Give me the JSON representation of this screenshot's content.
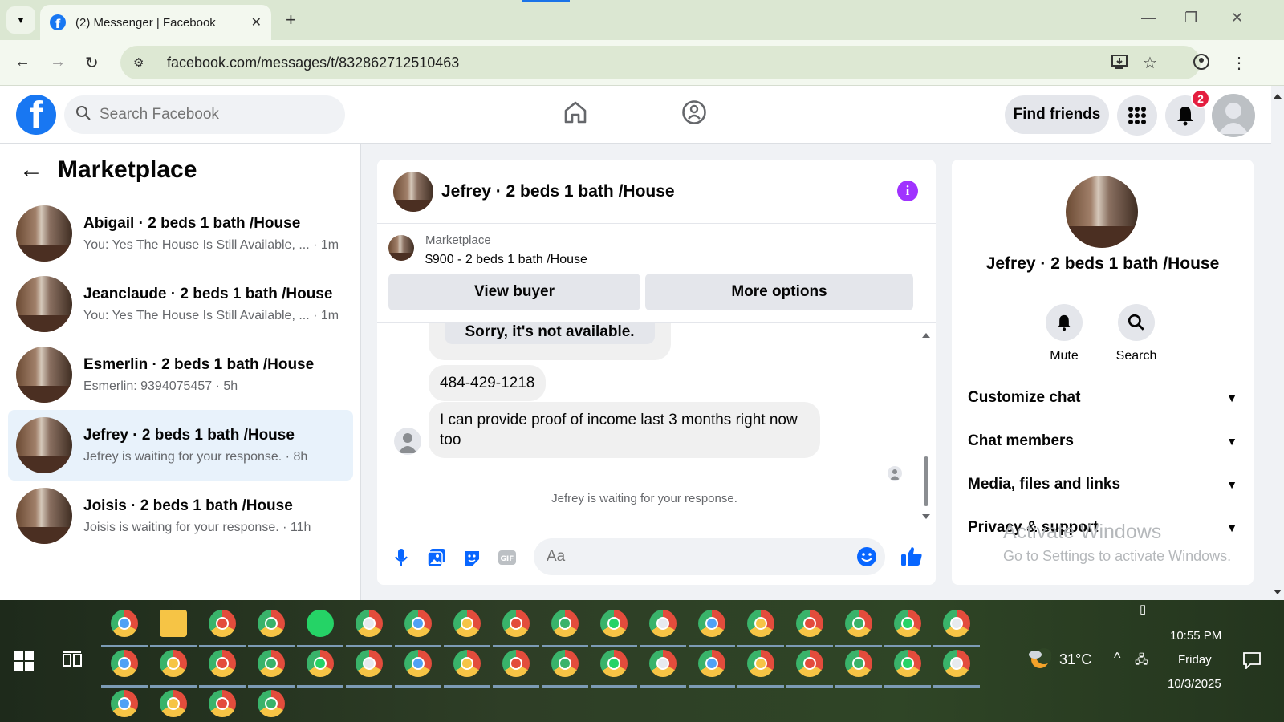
{
  "browser": {
    "tab_title": "(2) Messenger | Facebook",
    "url": "facebook.com/messages/t/832862712510463",
    "new_tab": "+",
    "close_tab": "✕"
  },
  "facebook": {
    "logo": "f",
    "search_placeholder": "Search Facebook",
    "find_friends": "Find friends",
    "notification_count": "2",
    "left_title": "Marketplace",
    "conversations": [
      {
        "name": "Abigail · 2 beds 1 bath /House",
        "snippet": "You: Yes The House Is Still Available, ...  · 1m"
      },
      {
        "name": "Jeanclaude · 2 beds 1 bath /House",
        "snippet": "You: Yes The House Is Still Available, ...  · 1m"
      },
      {
        "name": "Esmerlin · 2 beds 1 bath /House",
        "snippet": "Esmerlin: 9394075457 · 5h"
      },
      {
        "name": "Jefrey · 2 beds 1 bath /House",
        "snippet": "Jefrey is waiting for your response. · 8h"
      },
      {
        "name": "Joisis · 2 beds 1 bath /House",
        "snippet": "Joisis is waiting for your response. · 11h"
      }
    ],
    "chat": {
      "title": "Jefrey · 2 beds 1 bath /House",
      "marketplace_label": "Marketplace",
      "listing": "$900 - 2 beds 1 bath /House",
      "view_buyer": "View buyer",
      "more_options": "More options",
      "messages": [
        "Sorry, it's not available.",
        "484-429-1218",
        "I can provide proof of income last 3 months right now too"
      ],
      "waiting": "Jefrey is waiting for your response.",
      "composer_placeholder": "Aa"
    },
    "details": {
      "name": "Jefrey · 2 beds 1 bath /House",
      "mute": "Mute",
      "search": "Search",
      "sections": [
        "Customize chat",
        "Chat members",
        "Media, files and links",
        "Privacy & support"
      ],
      "watermark_title": "Activate Windows",
      "watermark_sub": "Go to Settings to activate Windows."
    }
  },
  "taskbar": {
    "weather": "31°C",
    "time": "10:55 PM",
    "day": "Friday",
    "date": "10/3/2025"
  },
  "colors": {
    "facebook_blue": "#1877f2",
    "messenger_blue": "#0866ff",
    "info_purple": "#a033ff",
    "badge_red": "#e41e3f",
    "active_conversation": "#e8f2fb"
  }
}
